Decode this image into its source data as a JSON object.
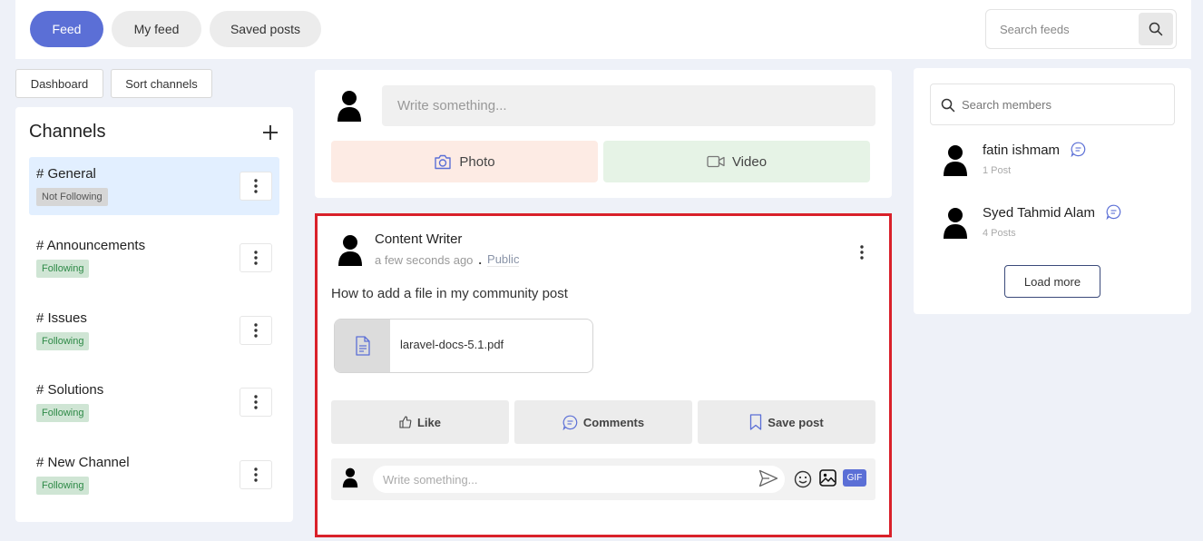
{
  "header": {
    "tabs": [
      {
        "label": "Feed",
        "active": true
      },
      {
        "label": "My feed",
        "active": false
      },
      {
        "label": "Saved posts",
        "active": false
      }
    ],
    "search_placeholder": "Search feeds"
  },
  "left": {
    "dashboard_label": "Dashboard",
    "sort_label": "Sort channels",
    "channels_title": "Channels",
    "channels": [
      {
        "name": "# General",
        "status": "Not Following",
        "selected": true
      },
      {
        "name": "# Announcements",
        "status": "Following",
        "selected": false
      },
      {
        "name": "# Issues",
        "status": "Following",
        "selected": false
      },
      {
        "name": "# Solutions",
        "status": "Following",
        "selected": false
      },
      {
        "name": "# New Channel",
        "status": "Following",
        "selected": false
      }
    ]
  },
  "composer": {
    "placeholder": "Write something...",
    "photo_label": "Photo",
    "video_label": "Video"
  },
  "post": {
    "author": "Content Writer",
    "time": "a few seconds ago",
    "separator": ".",
    "visibility": "Public",
    "text": "How to add a file in my community post",
    "file_name": "laravel-docs-5.1.pdf",
    "like_label": "Like",
    "comments_label": "Comments",
    "save_label": "Save post",
    "comment_placeholder": "Write something...",
    "gif_label": "GIF"
  },
  "members": {
    "search_placeholder": "Search members",
    "list": [
      {
        "name": "fatin ishmam",
        "posts": "1 Post"
      },
      {
        "name": "Syed Tahmid Alam",
        "posts": "4 Posts"
      }
    ],
    "load_more_label": "Load more"
  },
  "colors": {
    "accent": "#5b6fd6",
    "highlight_border": "#d9212a",
    "following_badge": "#cfe5d4",
    "photo_bg": "#fdebe4",
    "video_bg": "#e6f3e6"
  }
}
